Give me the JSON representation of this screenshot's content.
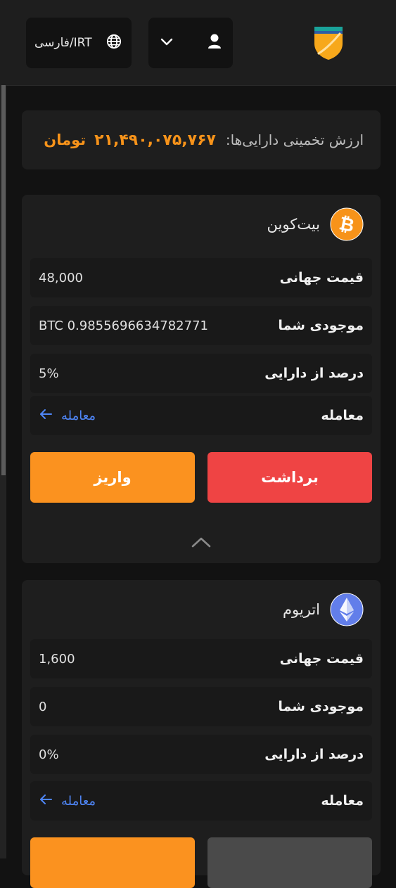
{
  "header": {
    "language": "فارسی/IRT",
    "icons": [
      "globe-icon",
      "chevron-down-icon",
      "user-icon",
      "shield-logo"
    ]
  },
  "summary": {
    "label": "ارزش تخمینی دارایی‌ها:",
    "value": "۲۱,۴۹۰,۰۷۵,۷۶۷",
    "unit": "تومان"
  },
  "assets": [
    {
      "name": "بیت‌کوین",
      "icon": "bitcoin-icon",
      "global_price_label": "قیمت جهانی",
      "global_price": "48,000",
      "balance_label": "موجودی شما",
      "balance": "BTC 0.9855696634782771",
      "percent_label": "درصد از دارایی",
      "percent": "5%",
      "trade_label": "معامله",
      "trade_link": "معامله",
      "deposit_label": "واریز",
      "withdraw_label": "برداشت"
    },
    {
      "name": "اتریوم",
      "icon": "ethereum-icon",
      "global_price_label": "قیمت جهانی",
      "global_price": "1,600",
      "balance_label": "موجودی شما",
      "balance": "0",
      "percent_label": "درصد از دارایی",
      "percent": "0%",
      "trade_label": "معامله",
      "trade_link": "معامله"
    }
  ],
  "colors": {
    "accent": "#fb921f",
    "danger": "#ef4444",
    "link": "#4f86f7",
    "background": "#121212",
    "card": "#1e1e1e"
  }
}
